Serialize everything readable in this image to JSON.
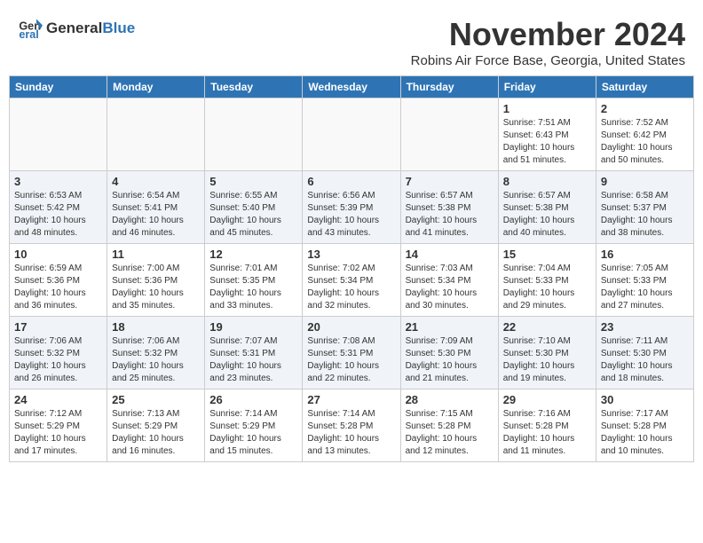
{
  "header": {
    "logo_general": "General",
    "logo_blue": "Blue",
    "month_title": "November 2024",
    "location": "Robins Air Force Base, Georgia, United States"
  },
  "days_of_week": [
    "Sunday",
    "Monday",
    "Tuesday",
    "Wednesday",
    "Thursday",
    "Friday",
    "Saturday"
  ],
  "weeks": [
    [
      {
        "day": "",
        "info": ""
      },
      {
        "day": "",
        "info": ""
      },
      {
        "day": "",
        "info": ""
      },
      {
        "day": "",
        "info": ""
      },
      {
        "day": "",
        "info": ""
      },
      {
        "day": "1",
        "info": "Sunrise: 7:51 AM\nSunset: 6:43 PM\nDaylight: 10 hours and 51 minutes."
      },
      {
        "day": "2",
        "info": "Sunrise: 7:52 AM\nSunset: 6:42 PM\nDaylight: 10 hours and 50 minutes."
      }
    ],
    [
      {
        "day": "3",
        "info": "Sunrise: 6:53 AM\nSunset: 5:42 PM\nDaylight: 10 hours and 48 minutes."
      },
      {
        "day": "4",
        "info": "Sunrise: 6:54 AM\nSunset: 5:41 PM\nDaylight: 10 hours and 46 minutes."
      },
      {
        "day": "5",
        "info": "Sunrise: 6:55 AM\nSunset: 5:40 PM\nDaylight: 10 hours and 45 minutes."
      },
      {
        "day": "6",
        "info": "Sunrise: 6:56 AM\nSunset: 5:39 PM\nDaylight: 10 hours and 43 minutes."
      },
      {
        "day": "7",
        "info": "Sunrise: 6:57 AM\nSunset: 5:38 PM\nDaylight: 10 hours and 41 minutes."
      },
      {
        "day": "8",
        "info": "Sunrise: 6:57 AM\nSunset: 5:38 PM\nDaylight: 10 hours and 40 minutes."
      },
      {
        "day": "9",
        "info": "Sunrise: 6:58 AM\nSunset: 5:37 PM\nDaylight: 10 hours and 38 minutes."
      }
    ],
    [
      {
        "day": "10",
        "info": "Sunrise: 6:59 AM\nSunset: 5:36 PM\nDaylight: 10 hours and 36 minutes."
      },
      {
        "day": "11",
        "info": "Sunrise: 7:00 AM\nSunset: 5:36 PM\nDaylight: 10 hours and 35 minutes."
      },
      {
        "day": "12",
        "info": "Sunrise: 7:01 AM\nSunset: 5:35 PM\nDaylight: 10 hours and 33 minutes."
      },
      {
        "day": "13",
        "info": "Sunrise: 7:02 AM\nSunset: 5:34 PM\nDaylight: 10 hours and 32 minutes."
      },
      {
        "day": "14",
        "info": "Sunrise: 7:03 AM\nSunset: 5:34 PM\nDaylight: 10 hours and 30 minutes."
      },
      {
        "day": "15",
        "info": "Sunrise: 7:04 AM\nSunset: 5:33 PM\nDaylight: 10 hours and 29 minutes."
      },
      {
        "day": "16",
        "info": "Sunrise: 7:05 AM\nSunset: 5:33 PM\nDaylight: 10 hours and 27 minutes."
      }
    ],
    [
      {
        "day": "17",
        "info": "Sunrise: 7:06 AM\nSunset: 5:32 PM\nDaylight: 10 hours and 26 minutes."
      },
      {
        "day": "18",
        "info": "Sunrise: 7:06 AM\nSunset: 5:32 PM\nDaylight: 10 hours and 25 minutes."
      },
      {
        "day": "19",
        "info": "Sunrise: 7:07 AM\nSunset: 5:31 PM\nDaylight: 10 hours and 23 minutes."
      },
      {
        "day": "20",
        "info": "Sunrise: 7:08 AM\nSunset: 5:31 PM\nDaylight: 10 hours and 22 minutes."
      },
      {
        "day": "21",
        "info": "Sunrise: 7:09 AM\nSunset: 5:30 PM\nDaylight: 10 hours and 21 minutes."
      },
      {
        "day": "22",
        "info": "Sunrise: 7:10 AM\nSunset: 5:30 PM\nDaylight: 10 hours and 19 minutes."
      },
      {
        "day": "23",
        "info": "Sunrise: 7:11 AM\nSunset: 5:30 PM\nDaylight: 10 hours and 18 minutes."
      }
    ],
    [
      {
        "day": "24",
        "info": "Sunrise: 7:12 AM\nSunset: 5:29 PM\nDaylight: 10 hours and 17 minutes."
      },
      {
        "day": "25",
        "info": "Sunrise: 7:13 AM\nSunset: 5:29 PM\nDaylight: 10 hours and 16 minutes."
      },
      {
        "day": "26",
        "info": "Sunrise: 7:14 AM\nSunset: 5:29 PM\nDaylight: 10 hours and 15 minutes."
      },
      {
        "day": "27",
        "info": "Sunrise: 7:14 AM\nSunset: 5:28 PM\nDaylight: 10 hours and 13 minutes."
      },
      {
        "day": "28",
        "info": "Sunrise: 7:15 AM\nSunset: 5:28 PM\nDaylight: 10 hours and 12 minutes."
      },
      {
        "day": "29",
        "info": "Sunrise: 7:16 AM\nSunset: 5:28 PM\nDaylight: 10 hours and 11 minutes."
      },
      {
        "day": "30",
        "info": "Sunrise: 7:17 AM\nSunset: 5:28 PM\nDaylight: 10 hours and 10 minutes."
      }
    ]
  ]
}
